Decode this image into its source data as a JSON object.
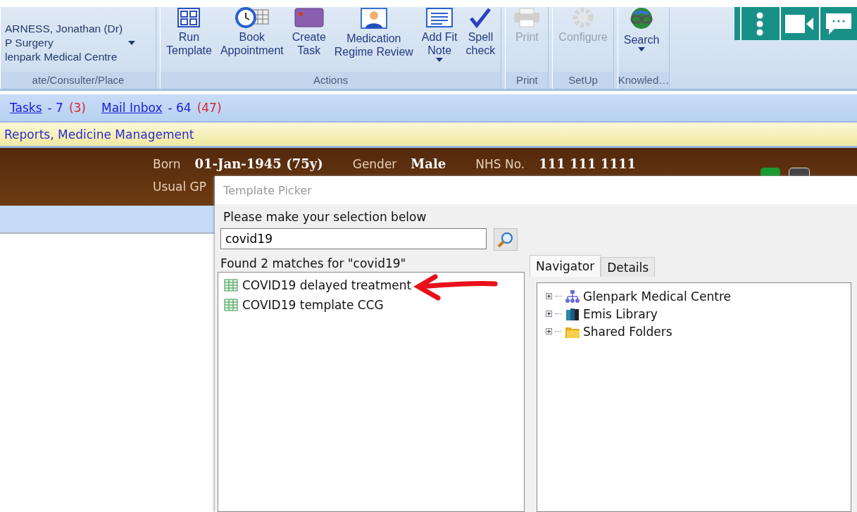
{
  "ribbon": {
    "consulter_group": {
      "lines": [
        "ARNESS, Jonathan (Dr)",
        "P Surgery",
        "lenpark Medical Centre"
      ],
      "label": "ate/Consulter/Place"
    },
    "groups": [
      {
        "label": "Actions",
        "buttons": [
          {
            "lines": [
              "Run",
              "Template"
            ],
            "kind": "grid",
            "disabled": false,
            "dropdown": false
          },
          {
            "lines": [
              "Book",
              "Appointment"
            ],
            "kind": "clock",
            "disabled": false,
            "dropdown": false
          },
          {
            "lines": [
              "Create",
              "Task"
            ],
            "kind": "task",
            "disabled": false,
            "dropdown": false
          },
          {
            "lines": [
              "Medication",
              "Regime Review"
            ],
            "kind": "person",
            "disabled": false,
            "dropdown": false
          },
          {
            "lines": [
              "Add Fit",
              "Note"
            ],
            "kind": "note",
            "disabled": false,
            "dropdown": true
          },
          {
            "lines": [
              "Spell",
              "check"
            ],
            "kind": "check",
            "disabled": false,
            "dropdown": false
          }
        ]
      },
      {
        "label": "Print",
        "buttons": [
          {
            "lines": [
              "Print"
            ],
            "kind": "printer",
            "disabled": true,
            "dropdown": false
          }
        ]
      },
      {
        "label": "SetUp",
        "buttons": [
          {
            "lines": [
              "Configure"
            ],
            "kind": "gear",
            "disabled": true,
            "dropdown": false
          }
        ]
      },
      {
        "label": "Knowled…",
        "buttons": [
          {
            "lines": [
              "Search"
            ],
            "kind": "globe",
            "disabled": false,
            "dropdown": true
          }
        ]
      }
    ]
  },
  "status_links": [
    {
      "label": "Tasks",
      "count": "- 7",
      "unread": "(3)"
    },
    {
      "label": "Mail Inbox",
      "count": "- 64",
      "unread": "(47)"
    }
  ],
  "alert_bar": "Reports, Medicine Management",
  "patient_banner": {
    "fields": [
      {
        "label": "Born",
        "value": "01-Jan-1945 (75y)"
      },
      {
        "label": "Gender",
        "value": "Male"
      },
      {
        "label": "NHS No.",
        "value": "111 111 1111"
      }
    ],
    "usual_gp_label": "Usual GP"
  },
  "dialog": {
    "title": "Template Picker",
    "prompt": "Please make your selection below",
    "search": {
      "value": "covid19"
    },
    "result_text": "Found 2 matches for \"covid19\"",
    "results": [
      {
        "label": "COVID19 delayed treatment"
      },
      {
        "label": "COVID19 template CCG"
      }
    ],
    "tabs": [
      {
        "label": "Navigator",
        "selected": true
      },
      {
        "label": "Details",
        "selected": false
      }
    ],
    "tree": [
      {
        "label": "Glenpark Medical Centre",
        "kind": "organisation",
        "expanded": false
      },
      {
        "label": "Emis Library",
        "kind": "library",
        "expanded": false
      },
      {
        "label": "Shared Folders",
        "kind": "folder",
        "expanded": false
      }
    ]
  }
}
